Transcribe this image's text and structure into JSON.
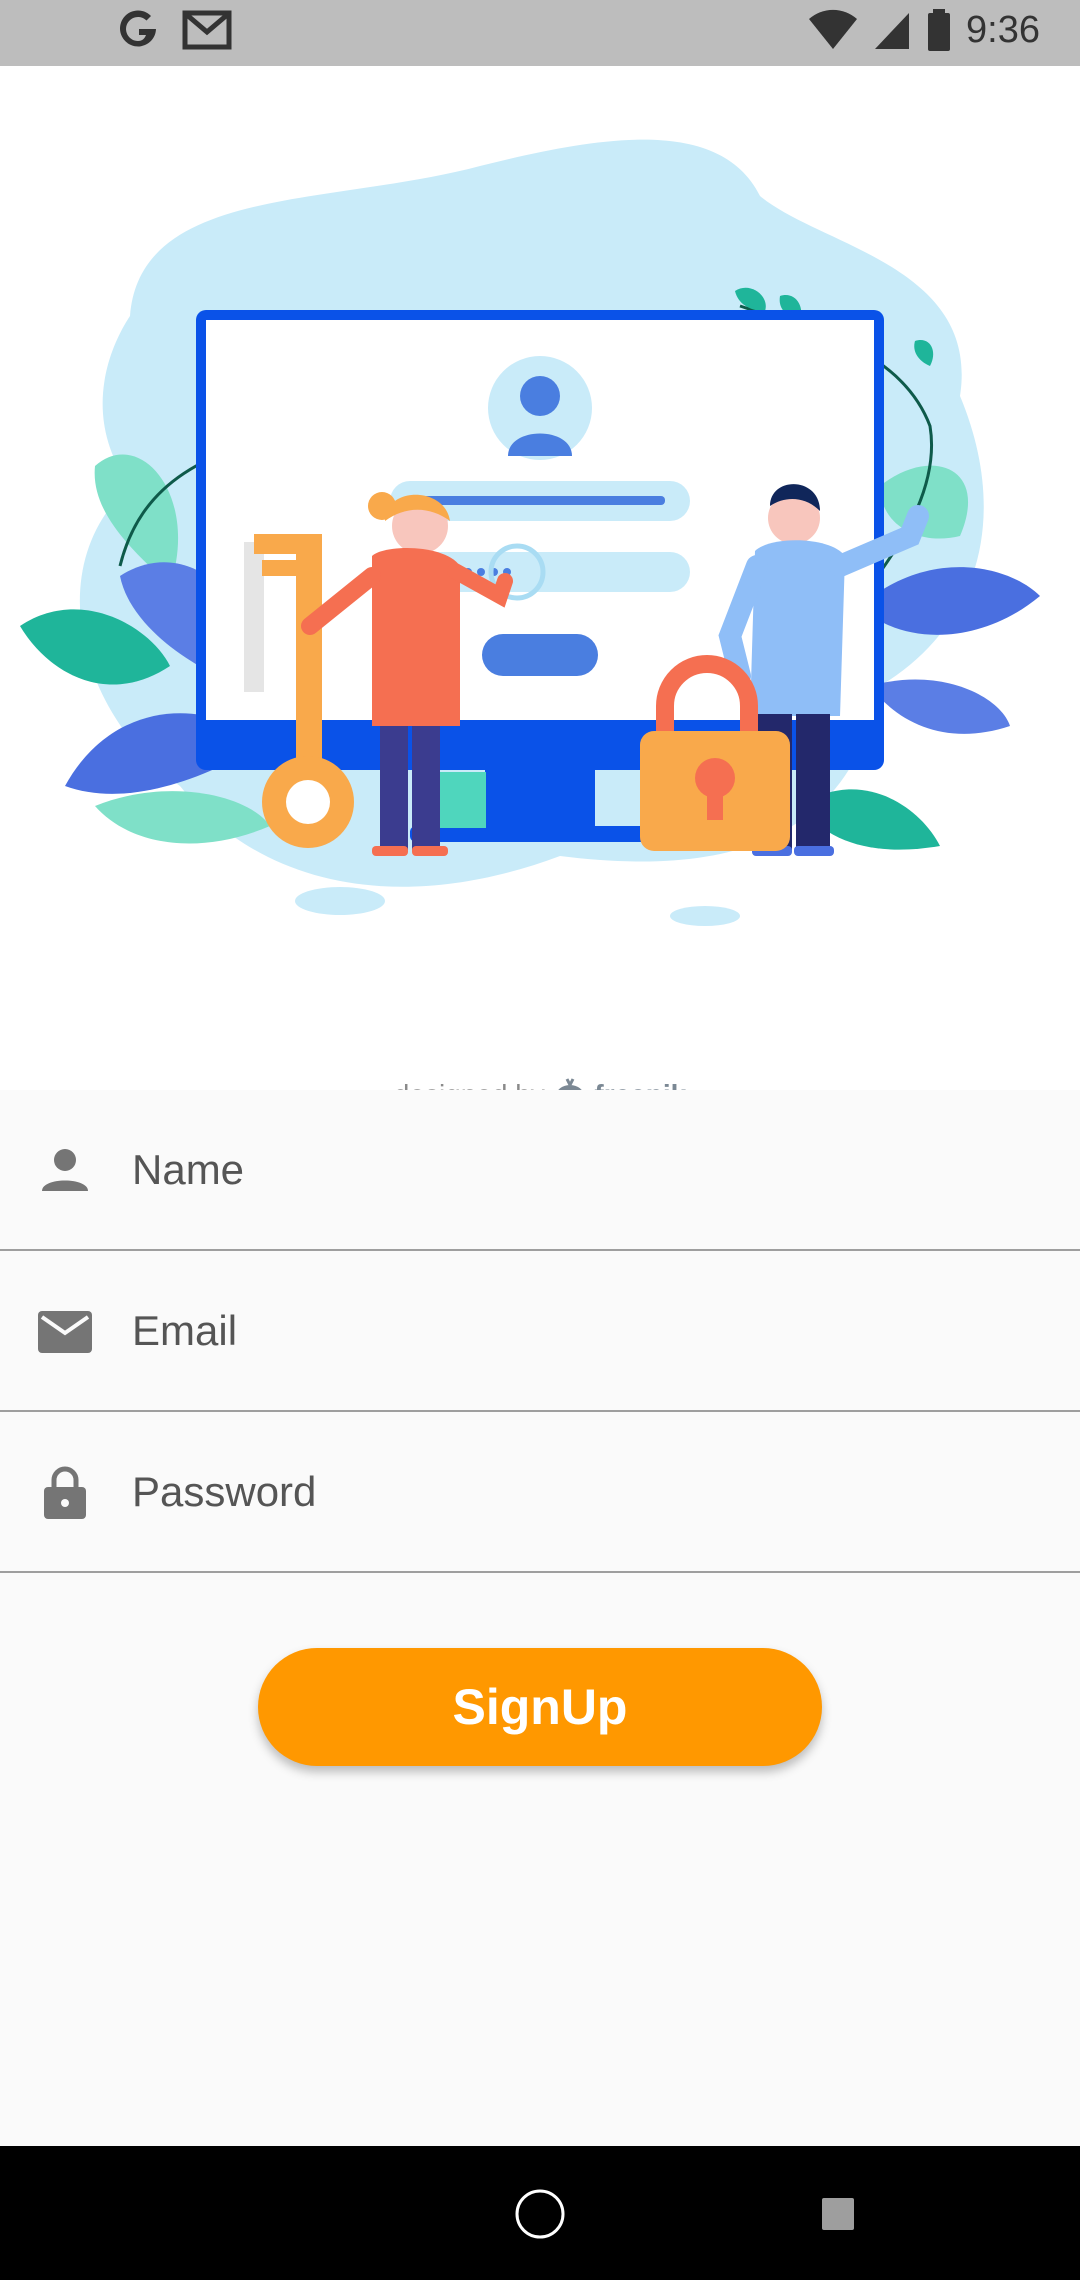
{
  "status_bar": {
    "time": "9:36",
    "left_icons": [
      "google-g-icon",
      "gmail-icon"
    ],
    "right_icons": [
      "wifi-icon",
      "signal-icon",
      "battery-icon"
    ]
  },
  "hero": {
    "credit_prefix": "designed by",
    "credit_brand": "freepik"
  },
  "form": {
    "name_placeholder": "Name",
    "email_placeholder": "Email",
    "password_placeholder": "Password",
    "signup_label": "SignUp",
    "accent_color": "#ff9800"
  },
  "nav_bar": {
    "buttons": [
      "home-button",
      "recents-button"
    ]
  }
}
